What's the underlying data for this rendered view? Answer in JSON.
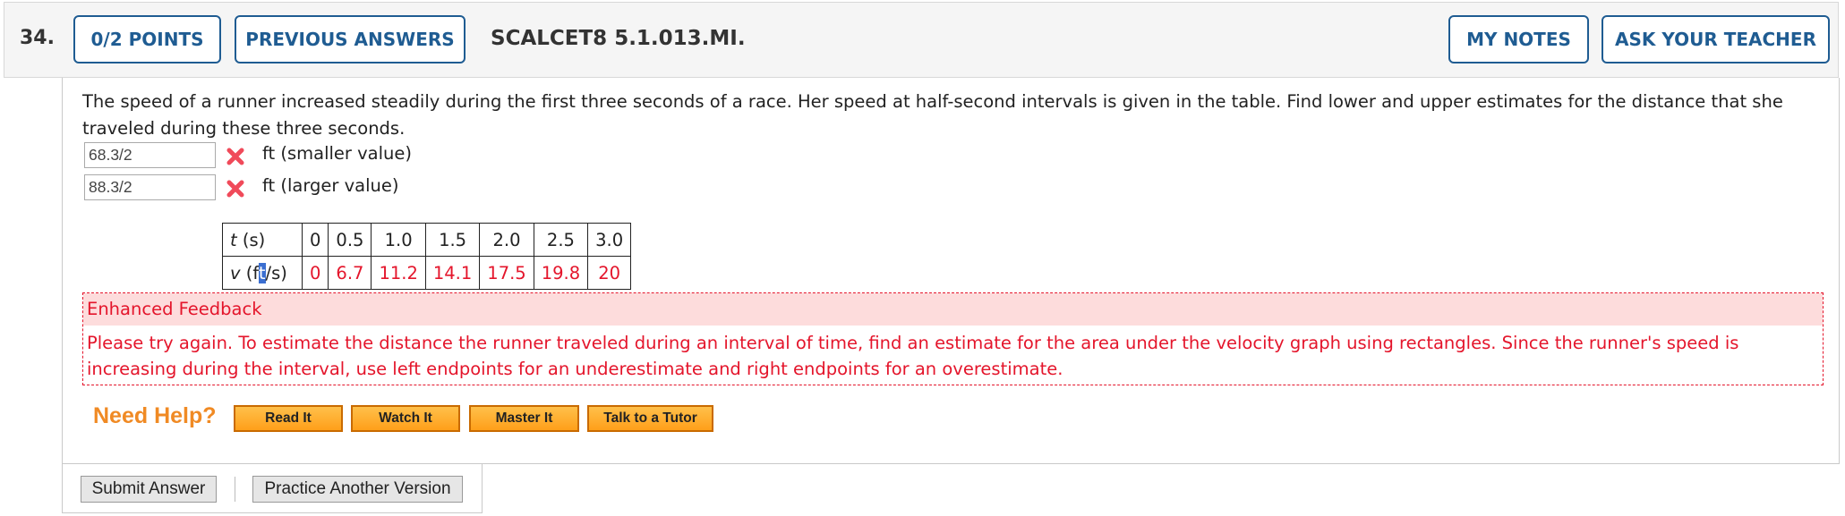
{
  "header": {
    "question_number": "34.",
    "points_button": "0/2 POINTS",
    "previous_answers_button": "PREVIOUS ANSWERS",
    "question_code": "SCALCET8 5.1.013.MI.",
    "my_notes_button": "MY NOTES",
    "ask_teacher_button": "ASK YOUR TEACHER"
  },
  "question": {
    "text": "The speed of a runner increased steadily during the first three seconds of a race. Her speed at half-second intervals is given in the table. Find lower and upper estimates for the distance that she traveled during these three seconds."
  },
  "answers": [
    {
      "value": "68.3/2",
      "unit": "ft (smaller value)",
      "status_icon": "incorrect-x-icon"
    },
    {
      "value": "88.3/2",
      "unit": "ft (larger value)",
      "status_icon": "incorrect-x-icon"
    }
  ],
  "table": {
    "t_label": {
      "var": "t",
      "unit": " (s)"
    },
    "t_values": [
      "0",
      "0.5",
      "1.0",
      "1.5",
      "2.0",
      "2.5",
      "3.0"
    ],
    "v_label": {
      "var": "v",
      "pre": " (f",
      "sel": "t",
      "post": "/s)"
    },
    "v_values": [
      "0",
      "6.7",
      "11.2",
      "14.1",
      "17.5",
      "19.8",
      "20"
    ]
  },
  "feedback": {
    "title": "Enhanced Feedback",
    "text": "Please try again. To estimate the distance the runner traveled during an interval of time, find an estimate for the area under the velocity graph using rectangles. Since the runner's speed is increasing during the interval, use left endpoints for an underestimate and right endpoints for an overestimate."
  },
  "help": {
    "label": "Need Help?",
    "buttons": [
      "Read It",
      "Watch It",
      "Master It",
      "Talk to a Tutor"
    ]
  },
  "footer": {
    "submit_button": "Submit Answer",
    "practice_button": "Practice Another Version"
  },
  "colors": {
    "accent_blue": "#1f5c92",
    "incorrect_red": "#e4152b",
    "feedback_bg": "#fddcdc",
    "help_orange": "#f08a24"
  }
}
